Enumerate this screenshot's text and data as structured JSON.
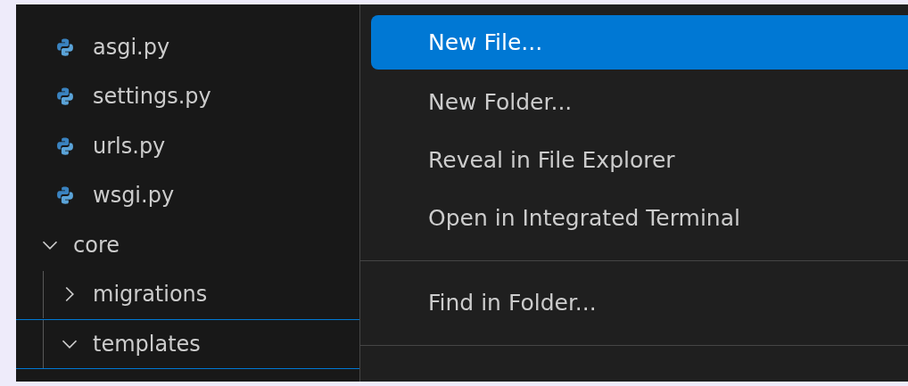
{
  "explorer": {
    "items": [
      {
        "kind": "file",
        "label": "asgi.py",
        "focused": false
      },
      {
        "kind": "file",
        "label": "settings.py",
        "focused": false
      },
      {
        "kind": "file",
        "label": "urls.py",
        "focused": false
      },
      {
        "kind": "file",
        "label": "wsgi.py",
        "focused": false
      },
      {
        "kind": "folder",
        "label": "core",
        "expanded": true,
        "focused": false,
        "children": [
          {
            "kind": "folder",
            "label": "migrations",
            "expanded": false,
            "focused": false
          },
          {
            "kind": "folder",
            "label": "templates",
            "expanded": true,
            "focused": true
          }
        ]
      }
    ]
  },
  "context_menu": {
    "items": [
      {
        "kind": "item",
        "label": "New File...",
        "selected": true
      },
      {
        "kind": "item",
        "label": "New Folder...",
        "selected": false
      },
      {
        "kind": "item",
        "label": "Reveal in File Explorer",
        "selected": false
      },
      {
        "kind": "item",
        "label": "Open in Integrated Terminal",
        "selected": false
      },
      {
        "kind": "separator"
      },
      {
        "kind": "item",
        "label": "Find in Folder...",
        "selected": false
      },
      {
        "kind": "separator"
      }
    ]
  }
}
